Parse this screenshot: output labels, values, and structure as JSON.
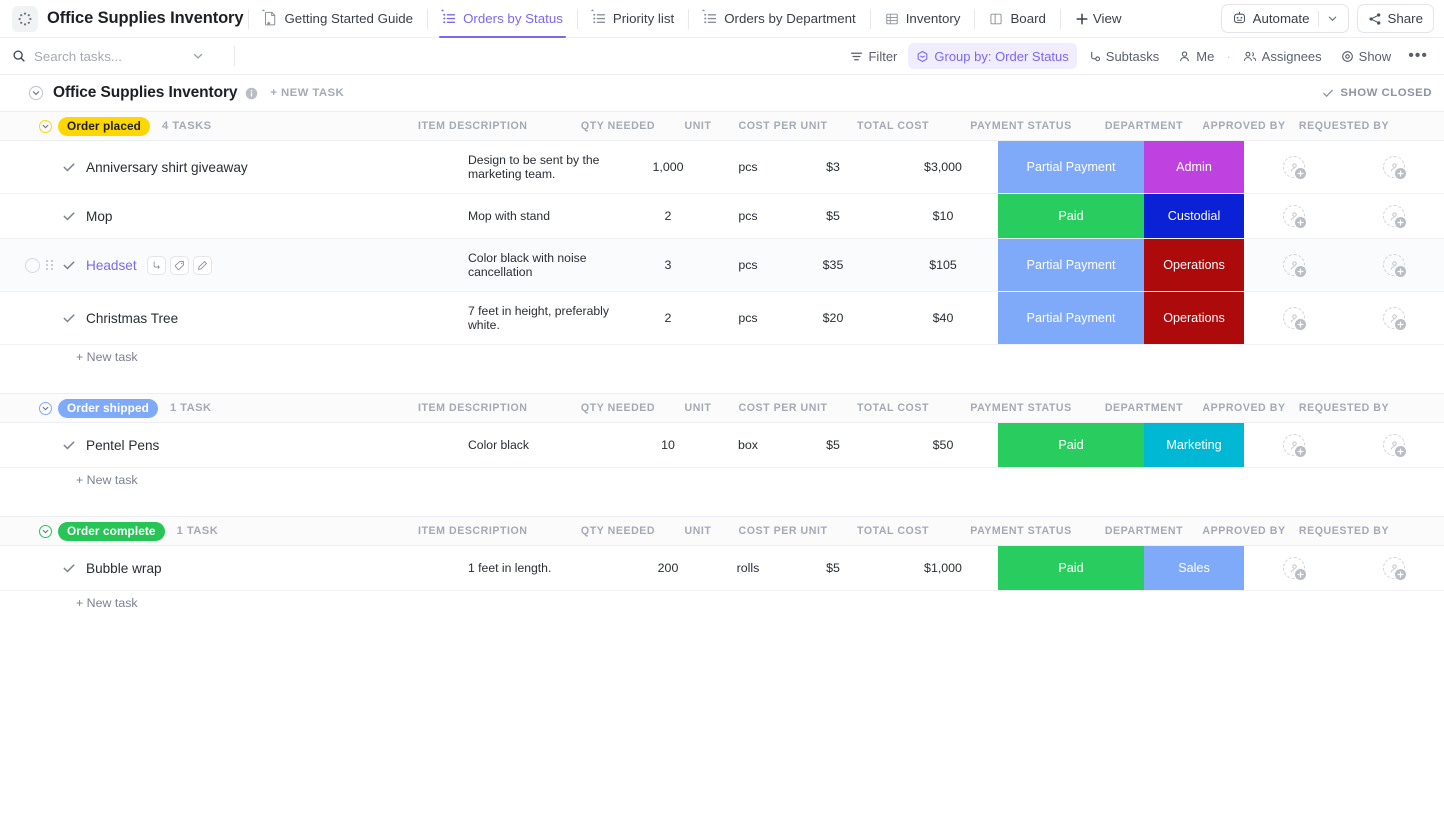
{
  "topbar": {
    "logo_icon": "dotted-circle-icon",
    "app_title": "Office Supplies Inventory",
    "tabs": [
      {
        "label": "Getting Started Guide",
        "icon": "doc-home-icon",
        "active": false
      },
      {
        "label": "Orders by Status",
        "icon": "list-icon",
        "active": true
      },
      {
        "label": "Priority list",
        "icon": "list-icon",
        "active": false
      },
      {
        "label": "Orders by Department",
        "icon": "list-icon",
        "active": false
      },
      {
        "label": "Inventory",
        "icon": "table-icon",
        "active": false
      },
      {
        "label": "Board",
        "icon": "board-icon",
        "active": false
      }
    ],
    "add_view_label": "View",
    "automate_label": "Automate",
    "automate_icon": "robot-icon",
    "share_label": "Share",
    "share_icon": "share-icon",
    "accent_color": "#7b68ee"
  },
  "filterbar": {
    "search_placeholder": "Search tasks...",
    "search_value": "",
    "search_icon": "search-icon",
    "filter_label": "Filter",
    "groupby_label": "Group by: Order Status",
    "subtasks_label": "Subtasks",
    "me_label": "Me",
    "assignees_label": "Assignees",
    "show_label": "Show",
    "kebab": "•••"
  },
  "listheader": {
    "title": "Office Supplies Inventory",
    "new_task_label": "+ NEW TASK",
    "show_closed_label": "SHOW CLOSED"
  },
  "columns": {
    "description": "ITEM DESCRIPTION",
    "qty": "QTY NEEDED",
    "unit": "UNIT",
    "cost_per_unit": "COST PER UNIT",
    "total_cost": "TOTAL COST",
    "payment_status": "PAYMENT STATUS",
    "department": "DEPARTMENT",
    "approved_by": "APPROVED BY",
    "requested_by": "REQUESTED BY"
  },
  "new_task_label": "+ New task",
  "groups": [
    {
      "status": "Order placed",
      "status_color": "#ffd700",
      "status_text_color": "#1d1f25",
      "count_label": "4 TASKS",
      "rows": [
        {
          "name": "Anniversary shirt giveaway",
          "description": "Design to be sent by the marketing team.",
          "qty": "1,000",
          "unit": "pcs",
          "cost_per_unit": "$3",
          "total_cost": "$3,000",
          "payment_status": "Partial Payment",
          "payment_color": "#7fa9f9",
          "department": "Admin",
          "department_color": "#bf42e0"
        },
        {
          "name": "Mop",
          "description": "Mop with stand",
          "qty": "2",
          "unit": "pcs",
          "cost_per_unit": "$5",
          "total_cost": "$10",
          "payment_status": "Paid",
          "payment_color": "#29cc5f",
          "department": "Custodial",
          "department_color": "#0a21d6"
        },
        {
          "name": "Headset",
          "description": "Color black with noise cancellation",
          "qty": "3",
          "unit": "pcs",
          "cost_per_unit": "$35",
          "total_cost": "$105",
          "payment_status": "Partial Payment",
          "payment_color": "#7fa9f9",
          "department": "Operations",
          "department_color": "#ad0b0b",
          "hovered": true,
          "link": true,
          "mini_icons": [
            "subtask-icon",
            "tag-icon",
            "edit-icon"
          ]
        },
        {
          "name": "Christmas Tree",
          "description": "7 feet in height, preferably white.",
          "qty": "2",
          "unit": "pcs",
          "cost_per_unit": "$20",
          "total_cost": "$40",
          "payment_status": "Partial Payment",
          "payment_color": "#7fa9f9",
          "department": "Operations",
          "department_color": "#ad0b0b"
        }
      ]
    },
    {
      "status": "Order shipped",
      "status_color": "#7fa9f9",
      "status_text_color": "#ffffff",
      "count_label": "1 TASK",
      "rows": [
        {
          "name": "Pentel Pens",
          "description": "Color black",
          "qty": "10",
          "unit": "box",
          "cost_per_unit": "$5",
          "total_cost": "$50",
          "payment_status": "Paid",
          "payment_color": "#29cc5f",
          "department": "Marketing",
          "department_color": "#01b8d4"
        }
      ]
    },
    {
      "status": "Order complete",
      "status_color": "#26c556",
      "status_text_color": "#ffffff",
      "count_label": "1 TASK",
      "rows": [
        {
          "name": "Bubble wrap",
          "description": "1 feet in length.",
          "qty": "200",
          "unit": "rolls",
          "cost_per_unit": "$5",
          "total_cost": "$1,000",
          "payment_status": "Paid",
          "payment_color": "#29cc5f",
          "department": "Sales",
          "department_color": "#7fa9f9"
        }
      ]
    }
  ]
}
